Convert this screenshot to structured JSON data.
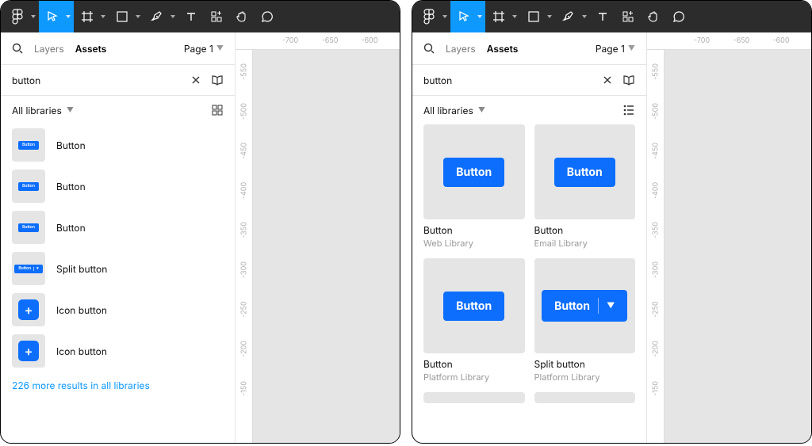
{
  "toolbar_tools": [
    "figma-menu",
    "move-tool",
    "frame-tool",
    "shape-tool",
    "pen-tool",
    "text-tool",
    "resources-tool",
    "hand-tool",
    "comment-tool"
  ],
  "sidebar_tabs": {
    "layers": "Layers",
    "assets": "Assets"
  },
  "page_selector": "Page 1",
  "search_term": "button",
  "filter_label": "All libraries",
  "ruler_h": [
    "-700",
    "-650",
    "-600"
  ],
  "ruler_v": [
    "-550",
    "-500",
    "-450",
    "-400",
    "-350",
    "-300",
    "-250",
    "-200",
    "-150"
  ],
  "left": {
    "view_mode": "list",
    "assets": [
      {
        "name": "Button",
        "kind": "button",
        "chip": "Button"
      },
      {
        "name": "Button",
        "kind": "button",
        "chip": "Button"
      },
      {
        "name": "Button",
        "kind": "button",
        "chip": "Button"
      },
      {
        "name": "Split button",
        "kind": "split",
        "chip": "Button"
      },
      {
        "name": "Icon button",
        "kind": "icon",
        "chip": "+"
      },
      {
        "name": "Icon button",
        "kind": "icon",
        "chip": "+"
      }
    ],
    "more_results": "226 more results in all libraries"
  },
  "right": {
    "view_mode": "grid",
    "cards": [
      {
        "name": "Button",
        "library": "Web Library",
        "kind": "button",
        "chip": "Button"
      },
      {
        "name": "Button",
        "library": "Email Library",
        "kind": "button",
        "chip": "Button"
      },
      {
        "name": "Button",
        "library": "Platform Library",
        "kind": "button",
        "chip": "Button"
      },
      {
        "name": "Split button",
        "library": "Platform Library",
        "kind": "split",
        "chip": "Button"
      }
    ]
  }
}
